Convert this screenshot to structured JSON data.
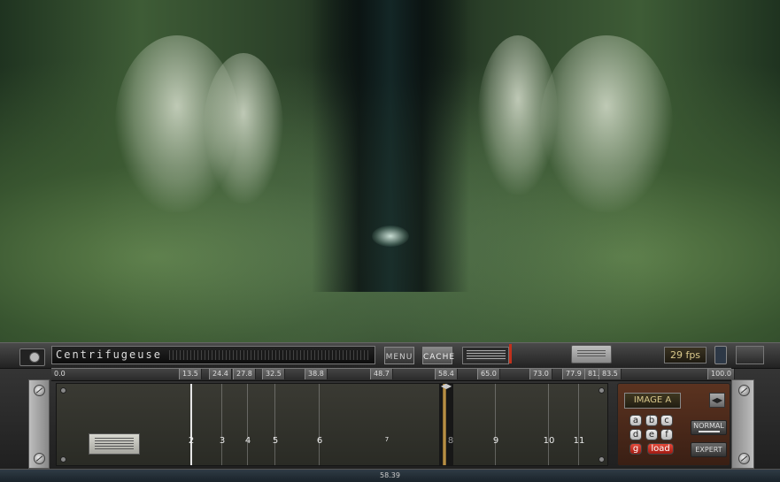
{
  "app": {
    "preset_name": "Centrifugeuse",
    "fps": "29 fps",
    "buttons": {
      "menu": "MENU",
      "cache": "CACHE"
    }
  },
  "ruler": {
    "ticks": [
      "0.0",
      "13.5",
      "24.4",
      "27.8",
      "32.5",
      "38.8",
      "48.7",
      "58.4",
      "65.0",
      "73.0",
      "77.9",
      "81.2",
      "83.5",
      "100.0"
    ]
  },
  "timeline": {
    "cues": [
      "2",
      "3",
      "4",
      "5",
      "6",
      "7",
      "8",
      "9",
      "10",
      "11"
    ],
    "active_cue": "2",
    "position_readout": "58.39"
  },
  "image_panel": {
    "current": "IMAGE A",
    "slots": [
      "a",
      "b",
      "c",
      "d",
      "e",
      "f",
      "g"
    ],
    "load_label": "load",
    "modes": {
      "normal": "NORMAL",
      "expert": "EXPERT"
    }
  },
  "colors": {
    "accent_red": "#c1311c",
    "lcd_text": "#d9c88b",
    "panel_brown": "#5b3320"
  }
}
